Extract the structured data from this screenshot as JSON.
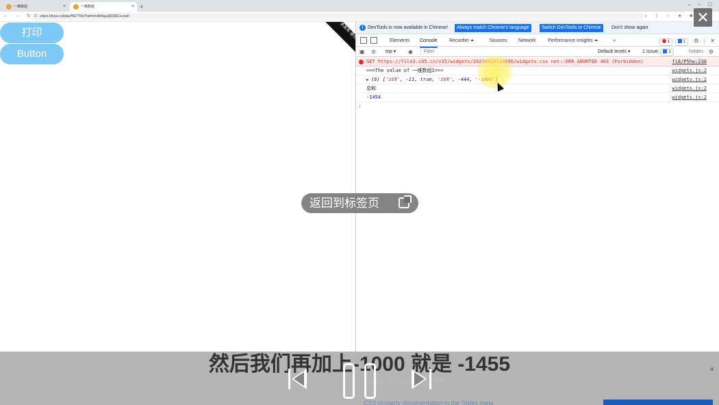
{
  "browser": {
    "tabs": [
      {
        "label": "一维数组"
      },
      {
        "label": "一维数组"
      }
    ],
    "new_tab_icon": "+",
    "url": "v4pre.h5sys.cn/play/HE7?6hr?oid=eh4kt0gu3j6000Cvczw0"
  },
  "page": {
    "print_button": "打印",
    "generic_button": "Button",
    "ribbon_text": "未发布 请勿分享"
  },
  "devtools": {
    "infobar": {
      "message": "DevTools is now available in Chinese!",
      "match_button": "Always match Chrome's language",
      "switch_button": "Switch DevTools to Chinese",
      "dismiss_button": "Don't show again"
    },
    "tabs": [
      {
        "label": "Elements"
      },
      {
        "label": "Console"
      },
      {
        "label": "Recorder ⏶"
      },
      {
        "label": "Sources"
      },
      {
        "label": "Network"
      },
      {
        "label": "Performance insights ⏶"
      },
      {
        "label": "»"
      }
    ],
    "error_count": "1",
    "message_count": "1",
    "toolbar": {
      "context": "top ▾",
      "filter_placeholder": "Filter",
      "levels": "Default levels ▾",
      "issues_label": "1 Issue:",
      "issues_count": "1",
      "hidden": "hidden"
    },
    "console": {
      "error_line": "GET https://file3.ih5.cn/v35/widgets/20230410114836/widgets.css net::ERR_ABORTED 403 (Forbidden)",
      "error_source": "fi8/P5hw:238",
      "log1": "===The value of 一维数组1===",
      "log1_source": "widgets.js:2",
      "array_prefix": "(6) [",
      "array_items": [
        "'iVX'",
        "-11",
        "true",
        "'iVX'",
        "-444",
        "'-1000'"
      ],
      "array_suffix": "]",
      "array_source": "widgets.js:2",
      "log3": "总和",
      "log3_source": "widgets.js:2",
      "log4": "-1454",
      "log4_source": "widgets.js:2",
      "prompt": "›"
    }
  },
  "overlay": {
    "return_label": "返回到标签页",
    "subtitle": "然后我们再加上-1000 就是 -1455",
    "behind_text": "Highlights from the Chrome 112 update",
    "behind_text2": "CSS property documentation in the Styles pane"
  }
}
